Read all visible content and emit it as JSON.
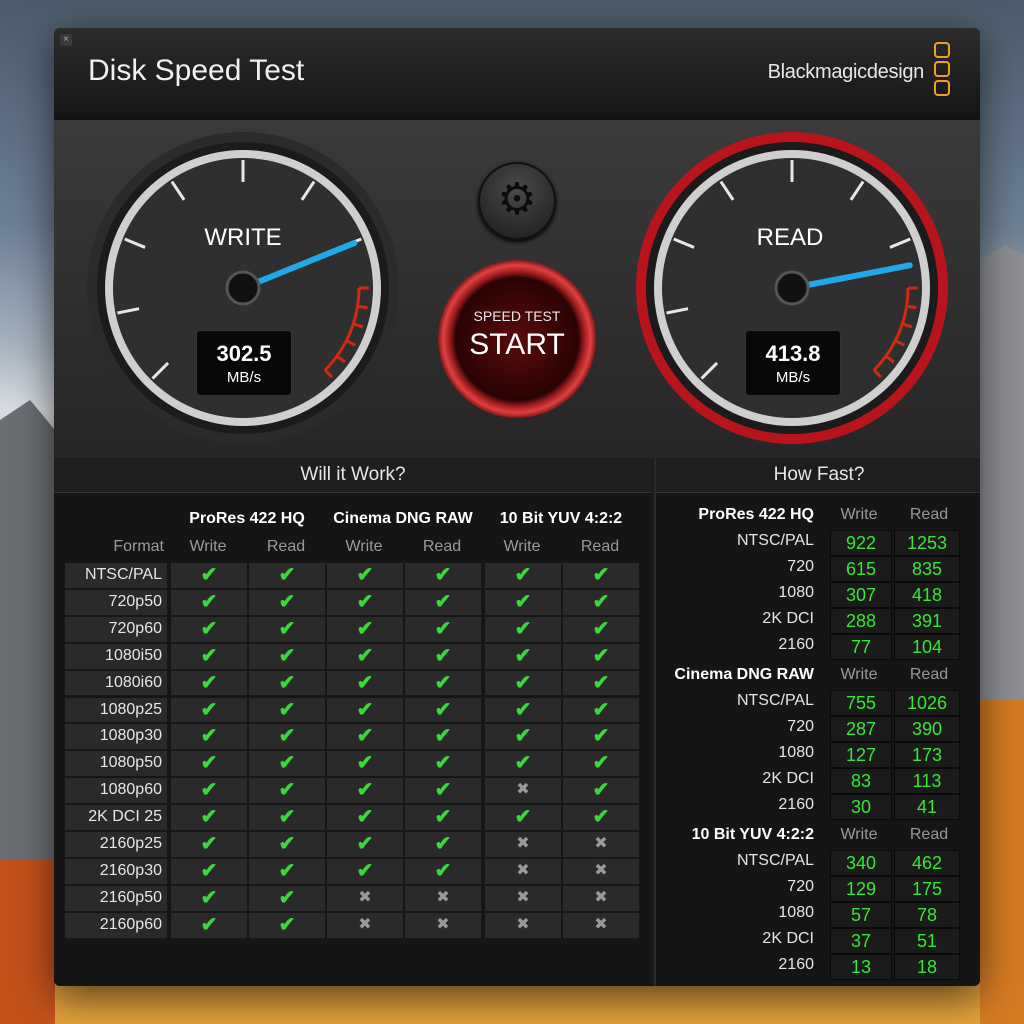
{
  "window": {
    "title": "Disk Speed Test",
    "brand": "Blackmagicdesign",
    "close_glyph": "×"
  },
  "gauges": {
    "write": {
      "label": "WRITE",
      "value": "302.5",
      "unit": "MB/s",
      "level_mbps": 302.5
    },
    "read": {
      "label": "READ",
      "value": "413.8",
      "unit": "MB/s",
      "level_mbps": 413.8
    },
    "start_button": {
      "line1": "SPEED TEST",
      "line2": "START"
    },
    "settings_icon": "gear-icon"
  },
  "will_it_work": {
    "title": "Will it Work?",
    "format_label": "Format",
    "codecs": [
      "ProRes 422 HQ",
      "Cinema DNG RAW",
      "10 Bit YUV 4:2:2"
    ],
    "subheads": [
      "Write",
      "Read"
    ],
    "rows": [
      {
        "format": "NTSC/PAL",
        "results": [
          1,
          1,
          1,
          1,
          1,
          1
        ]
      },
      {
        "format": "720p50",
        "results": [
          1,
          1,
          1,
          1,
          1,
          1
        ]
      },
      {
        "format": "720p60",
        "results": [
          1,
          1,
          1,
          1,
          1,
          1
        ]
      },
      {
        "format": "1080i50",
        "results": [
          1,
          1,
          1,
          1,
          1,
          1
        ]
      },
      {
        "format": "1080i60",
        "results": [
          1,
          1,
          1,
          1,
          1,
          1
        ]
      },
      {
        "format": "1080p25",
        "results": [
          1,
          1,
          1,
          1,
          1,
          1
        ]
      },
      {
        "format": "1080p30",
        "results": [
          1,
          1,
          1,
          1,
          1,
          1
        ]
      },
      {
        "format": "1080p50",
        "results": [
          1,
          1,
          1,
          1,
          1,
          1
        ]
      },
      {
        "format": "1080p60",
        "results": [
          1,
          1,
          1,
          1,
          0,
          1
        ]
      },
      {
        "format": "2K DCI 25",
        "results": [
          1,
          1,
          1,
          1,
          1,
          1
        ]
      },
      {
        "format": "2160p25",
        "results": [
          1,
          1,
          1,
          1,
          0,
          0
        ]
      },
      {
        "format": "2160p30",
        "results": [
          1,
          1,
          1,
          1,
          0,
          0
        ]
      },
      {
        "format": "2160p50",
        "results": [
          1,
          1,
          0,
          0,
          0,
          0
        ]
      },
      {
        "format": "2160p60",
        "results": [
          1,
          1,
          0,
          0,
          0,
          0
        ]
      }
    ],
    "check_glyph": "✔",
    "cross_glyph": "✖"
  },
  "how_fast": {
    "title": "How Fast?",
    "write_label": "Write",
    "read_label": "Read",
    "groups": [
      {
        "codec": "ProRes 422 HQ",
        "rows": [
          {
            "format": "NTSC/PAL",
            "write": "922",
            "read": "1253"
          },
          {
            "format": "720",
            "write": "615",
            "read": "835"
          },
          {
            "format": "1080",
            "write": "307",
            "read": "418"
          },
          {
            "format": "2K DCI",
            "write": "288",
            "read": "391"
          },
          {
            "format": "2160",
            "write": "77",
            "read": "104"
          }
        ]
      },
      {
        "codec": "Cinema DNG RAW",
        "rows": [
          {
            "format": "NTSC/PAL",
            "write": "755",
            "read": "1026"
          },
          {
            "format": "720",
            "write": "287",
            "read": "390"
          },
          {
            "format": "1080",
            "write": "127",
            "read": "173"
          },
          {
            "format": "2K DCI",
            "write": "83",
            "read": "113"
          },
          {
            "format": "2160",
            "write": "30",
            "read": "41"
          }
        ]
      },
      {
        "codec": "10 Bit YUV 4:2:2",
        "rows": [
          {
            "format": "NTSC/PAL",
            "write": "340",
            "read": "462"
          },
          {
            "format": "720",
            "write": "129",
            "read": "175"
          },
          {
            "format": "1080",
            "write": "57",
            "read": "78"
          },
          {
            "format": "2K DCI",
            "write": "37",
            "read": "51"
          },
          {
            "format": "2160",
            "write": "13",
            "read": "18"
          }
        ]
      }
    ]
  },
  "colors": {
    "accent_green": "#37e637",
    "read_ring": "#b8141c",
    "needle": "#20a8e8",
    "logo": "#f0a020"
  }
}
